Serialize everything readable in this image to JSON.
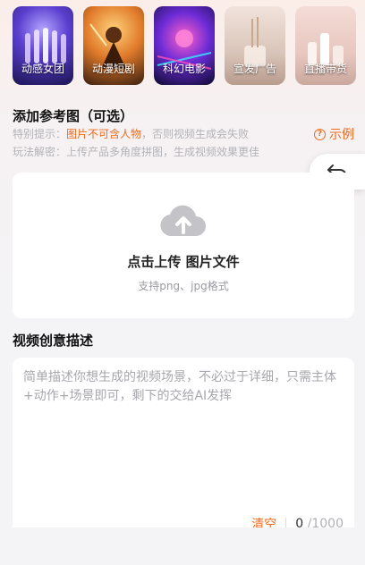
{
  "templates": [
    {
      "label": "动感女团"
    },
    {
      "label": "动漫短剧"
    },
    {
      "label": "科幻电影"
    },
    {
      "label": "宣发广告"
    },
    {
      "label": "直播带货"
    }
  ],
  "reference": {
    "title": "添加参考图（可选）",
    "hint1_prefix": "特别提示：",
    "hint1_warn": "图片不可含人物",
    "hint1_suffix": "，否则视频生成会失败",
    "hint2": "玩法解密：上传产品多角度拼图，生成视频效果更佳",
    "example_label": "示例",
    "accent_color": "#f06a1d"
  },
  "upload": {
    "title": "点击上传 图片文件",
    "subtitle": "支持png、jpg格式"
  },
  "description": {
    "title": "视频创意描述",
    "placeholder": "简单描述你想生成的视频场景，不必过于详细，只需主体+动作+场景即可，剩下的交给AI发挥",
    "clear_label": "清空",
    "count": "0",
    "max": "/1000"
  }
}
